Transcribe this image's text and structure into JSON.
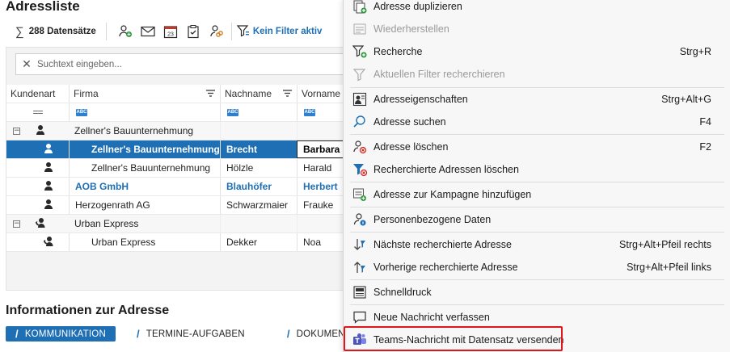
{
  "page": {
    "title": "Adressliste"
  },
  "toolbar": {
    "record_count": "288 Datensätze",
    "filter_label": "Kein Filter aktiv",
    "icons": [
      "add-person-icon",
      "mail-icon",
      "calendar-icon",
      "task-icon",
      "link-person-icon",
      "filter-icon"
    ]
  },
  "search": {
    "placeholder": "Suchtext eingeben..."
  },
  "grid": {
    "columns": {
      "kundenart": "Kundenart",
      "firma": "Firma",
      "nachname": "Nachname",
      "vorname": "Vorname"
    },
    "rows": [
      {
        "type": "group",
        "firma": "Zellner's Bauunternehmung",
        "nachname": "",
        "vorname": ""
      },
      {
        "type": "person",
        "firma": "Zellner's Bauunternehmung",
        "nachname": "Brecht",
        "vorname": "Barbara",
        "selected": true
      },
      {
        "type": "person",
        "firma": "Zellner's Bauunternehmung",
        "nachname": "Hölzle",
        "vorname": "Harald"
      },
      {
        "type": "person",
        "firma": "AOB GmbH",
        "nachname": "Blauhöfer",
        "vorname": "Herbert",
        "bold": true
      },
      {
        "type": "person",
        "firma": "Herzogenrath AG",
        "nachname": "Schwarzmaier",
        "vorname": "Frauke"
      },
      {
        "type": "group",
        "firma": "Urban Express",
        "nachname": "",
        "vorname": ""
      },
      {
        "type": "person",
        "firma": "Urban Express",
        "nachname": "Dekker",
        "vorname": "Noa"
      }
    ]
  },
  "info": {
    "title": "Informationen zur Adresse",
    "tabs": [
      "KOMMUNIKATION",
      "TERMINE-AUFGABEN",
      "DOKUMENTE"
    ]
  },
  "menu": {
    "items": [
      {
        "label": "Adresse duplizieren",
        "shortcut": "",
        "icon": "duplicate-icon",
        "disabled": false
      },
      {
        "label": "Wiederherstellen",
        "shortcut": "",
        "icon": "restore-icon",
        "disabled": true
      },
      {
        "label": "Recherche",
        "shortcut": "Strg+R",
        "icon": "filter-add-icon",
        "disabled": false
      },
      {
        "label": "Aktuellen Filter recherchieren",
        "shortcut": "",
        "icon": "filter-icon",
        "disabled": true
      },
      {
        "label": "Adresseigenschaften",
        "shortcut": "Strg+Alt+G",
        "icon": "address-properties-icon",
        "disabled": false
      },
      {
        "label": "Adresse suchen",
        "shortcut": "F4",
        "icon": "search-icon",
        "disabled": false
      },
      {
        "label": "Adresse löschen",
        "shortcut": "F2",
        "icon": "delete-person-icon",
        "disabled": false
      },
      {
        "label": "Recherchierte Adressen löschen",
        "shortcut": "",
        "icon": "filter-delete-icon",
        "disabled": false
      },
      {
        "label": "Adresse zur Kampagne hinzufügen",
        "shortcut": "",
        "icon": "campaign-icon",
        "disabled": false
      },
      {
        "label": "Personenbezogene Daten",
        "shortcut": "",
        "icon": "personal-data-icon",
        "disabled": false
      },
      {
        "label": "Nächste recherchierte Adresse",
        "shortcut": "Strg+Alt+Pfeil rechts",
        "icon": "arrow-down-icon",
        "disabled": false
      },
      {
        "label": "Vorherige recherchierte Adresse",
        "shortcut": "Strg+Alt+Pfeil links",
        "icon": "arrow-up-icon",
        "disabled": false
      },
      {
        "label": "Schnelldruck",
        "shortcut": "",
        "icon": "print-icon",
        "disabled": false
      },
      {
        "label": "Neue Nachricht verfassen",
        "shortcut": "",
        "icon": "message-icon",
        "disabled": false
      },
      {
        "label": "Teams-Nachricht mit Datensatz versenden",
        "shortcut": "",
        "icon": "teams-icon",
        "disabled": false
      }
    ]
  },
  "colors": {
    "accent": "#1f6fb5",
    "highlight_border": "#e0161b",
    "disabled_text": "#9a9a9a"
  }
}
